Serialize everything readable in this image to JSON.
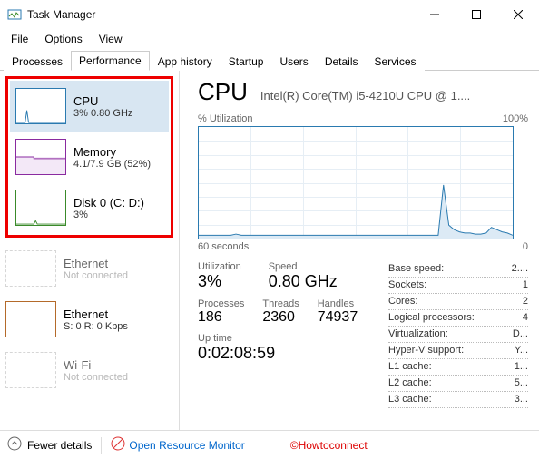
{
  "window": {
    "title": "Task Manager"
  },
  "menu": {
    "file": "File",
    "options": "Options",
    "view": "View"
  },
  "tabs": [
    "Processes",
    "Performance",
    "App history",
    "Startup",
    "Users",
    "Details",
    "Services"
  ],
  "active_tab": 1,
  "sidebar": [
    {
      "title": "CPU",
      "sub": "3% 0.80 GHz",
      "color": "#2a7ab0",
      "selected": true
    },
    {
      "title": "Memory",
      "sub": "4.1/7.9 GB (52%)",
      "color": "#8a2aa0"
    },
    {
      "title": "Disk 0 (C: D:)",
      "sub": "3%",
      "color": "#3a8a2a"
    },
    {
      "title": "Ethernet",
      "sub": "Not connected",
      "color": "#bbb",
      "dim": true
    },
    {
      "title": "Ethernet",
      "sub": "S: 0 R: 0 Kbps",
      "color": "#b46a2a"
    },
    {
      "title": "Wi-Fi",
      "sub": "Not connected",
      "color": "#bbb",
      "dim": true
    }
  ],
  "main": {
    "title": "CPU",
    "subtitle": "Intel(R) Core(TM) i5-4210U CPU @ 1....",
    "graph": {
      "ylabel": "% Utilization",
      "ymax": "100%",
      "xleft": "60 seconds",
      "xright": "0"
    },
    "utilization_lbl": "Utilization",
    "utilization": "3%",
    "speed_lbl": "Speed",
    "speed": "0.80 GHz",
    "processes_lbl": "Processes",
    "processes": "186",
    "threads_lbl": "Threads",
    "threads": "2360",
    "handles_lbl": "Handles",
    "handles": "74937",
    "uptime_lbl": "Up time",
    "uptime": "0:02:08:59",
    "info": [
      {
        "k": "Base speed:",
        "v": "2...."
      },
      {
        "k": "Sockets:",
        "v": "1"
      },
      {
        "k": "Cores:",
        "v": "2"
      },
      {
        "k": "Logical processors:",
        "v": "4"
      },
      {
        "k": "Virtualization:",
        "v": "D..."
      },
      {
        "k": "Hyper-V support:",
        "v": "Y..."
      },
      {
        "k": "L1 cache:",
        "v": "1..."
      },
      {
        "k": "L2 cache:",
        "v": "5..."
      },
      {
        "k": "L3 cache:",
        "v": "3..."
      }
    ]
  },
  "footer": {
    "fewer": "Fewer details",
    "orm": "Open Resource Monitor"
  },
  "watermark": "©Howtoconnect",
  "chart_data": {
    "type": "line",
    "title": "% Utilization",
    "xlabel": "seconds",
    "xrange": [
      60,
      0
    ],
    "ylabel": "%",
    "ylim": [
      0,
      100
    ],
    "series": [
      {
        "name": "CPU",
        "values": [
          3,
          3,
          3,
          3,
          3,
          3,
          3,
          4,
          3,
          3,
          3,
          3,
          3,
          3,
          3,
          3,
          3,
          3,
          3,
          3,
          3,
          3,
          3,
          3,
          3,
          3,
          3,
          3,
          3,
          3,
          3,
          3,
          3,
          3,
          3,
          3,
          3,
          3,
          3,
          3,
          3,
          3,
          3,
          3,
          3,
          3,
          48,
          12,
          8,
          6,
          5,
          5,
          4,
          4,
          5,
          10,
          8,
          6,
          5,
          3
        ]
      }
    ]
  }
}
